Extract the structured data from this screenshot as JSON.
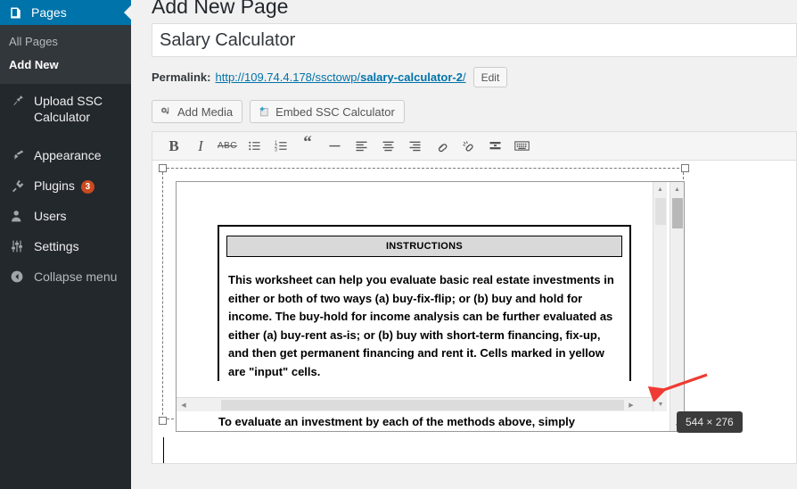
{
  "sidebar": {
    "current_menu": {
      "label": "Pages",
      "icon": "page-icon"
    },
    "submenu": [
      {
        "label": "All Pages",
        "current": false
      },
      {
        "label": "Add New",
        "current": true
      }
    ],
    "items": [
      {
        "label": "Upload SSC Calculator",
        "icon": "pin-icon",
        "badge": null
      },
      {
        "label": "Appearance",
        "icon": "paintbrush-icon",
        "badge": null
      },
      {
        "label": "Plugins",
        "icon": "plug-icon",
        "badge": "3"
      },
      {
        "label": "Users",
        "icon": "user-icon",
        "badge": null
      },
      {
        "label": "Settings",
        "icon": "sliders-icon",
        "badge": null
      },
      {
        "label": "Collapse menu",
        "icon": "collapse-arrow-icon",
        "badge": null
      }
    ],
    "colors": {
      "background": "#23282d",
      "submenu_background": "#32373c",
      "current_highlight": "#0073aa",
      "badge": "#ca4a1f"
    }
  },
  "main": {
    "heading": "Add New Page",
    "title_field": {
      "value": "Salary Calculator",
      "placeholder": "Enter title here"
    },
    "permalink": {
      "label": "Permalink:",
      "base": "http://109.74.4.178/ssctowp/",
      "slug": "salary-calculator-2",
      "trailing": "/",
      "full": "http://109.74.4.178/ssctowp/salary-calculator-2/",
      "edit_button": "Edit"
    },
    "media_buttons": [
      {
        "label": "Add Media",
        "icon": "add-media-icon"
      },
      {
        "label": "Embed SSC Calculator",
        "icon": "embed-plus-icon"
      }
    ],
    "toolbar": [
      {
        "name": "bold",
        "glyph": "B",
        "title": "Bold"
      },
      {
        "name": "italic",
        "glyph": "I",
        "title": "Italic"
      },
      {
        "name": "strikethrough",
        "glyph": "ABC",
        "title": "Strikethrough"
      },
      {
        "name": "bullet-list",
        "glyph": "",
        "title": "Bulleted list"
      },
      {
        "name": "numbered-list",
        "glyph": "",
        "title": "Numbered list"
      },
      {
        "name": "blockquote",
        "glyph": "“",
        "title": "Blockquote"
      },
      {
        "name": "horizontal-line",
        "glyph": "",
        "title": "Horizontal line"
      },
      {
        "name": "align-left",
        "glyph": "",
        "title": "Align left"
      },
      {
        "name": "align-center",
        "glyph": "",
        "title": "Align center"
      },
      {
        "name": "align-right",
        "glyph": "",
        "title": "Align right"
      },
      {
        "name": "insert-link",
        "glyph": "",
        "title": "Insert/edit link"
      },
      {
        "name": "remove-link",
        "glyph": "",
        "title": "Remove link"
      },
      {
        "name": "read-more",
        "glyph": "",
        "title": "Insert Read More tag"
      },
      {
        "name": "keyboard-shortcuts",
        "glyph": "",
        "title": "Keyboard shortcuts"
      }
    ],
    "embedded_document": {
      "instructions_header": "INSTRUCTIONS",
      "body": "This worksheet can help you evaluate basic real estate investments in either or both of two ways (a) buy-fix-flip; or (b) buy and hold for income.  The buy-hold for income analysis can be further evaluated as either (a) buy-rent as-is; or (b) buy with short-term financing, fix-up, and then get permanent financing and rent it.  Cells marked in yellow are \"input\" cells.",
      "tail_line": "To evaluate an investment by each of the methods above, simply"
    },
    "size_badge": "544 × 276"
  }
}
